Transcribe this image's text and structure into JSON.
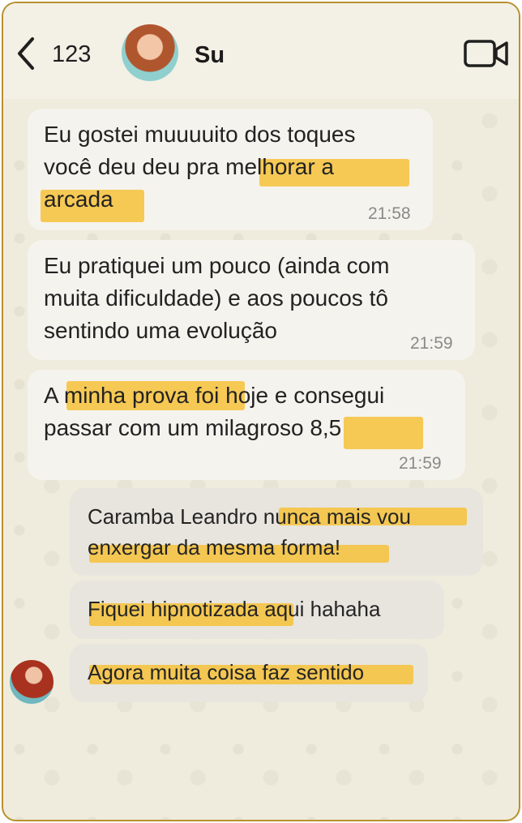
{
  "header": {
    "back_count": "123",
    "contact_name": "Su"
  },
  "messages": [
    {
      "lines": [
        "Eu gostei muuuuito dos toques",
        "você deu deu pra melhorar a",
        "arcada"
      ],
      "time": "21:58"
    },
    {
      "lines": [
        "Eu pratiquei um pouco (ainda com",
        "muita dificuldade) e aos poucos tô",
        "sentindo uma evolução"
      ],
      "time": "21:59"
    },
    {
      "lines": [
        "A minha prova foi hoje e consegui",
        "passar com um milagroso 8,5"
      ],
      "time": "21:59"
    },
    {
      "lines": [
        "Caramba Leandro nunca mais vou",
        "enxergar da mesma forma!"
      ]
    },
    {
      "lines": [
        "Fiquei hipnotizada aqui hahaha"
      ]
    },
    {
      "lines": [
        "Agora muita coisa faz sentido"
      ]
    }
  ],
  "icons": {
    "back": "chevron-left-icon",
    "video": "video-camera-icon"
  },
  "colors": {
    "highlight": "#f6bf33",
    "frame_border": "#b8912f",
    "chat_background": "#efebdd"
  }
}
